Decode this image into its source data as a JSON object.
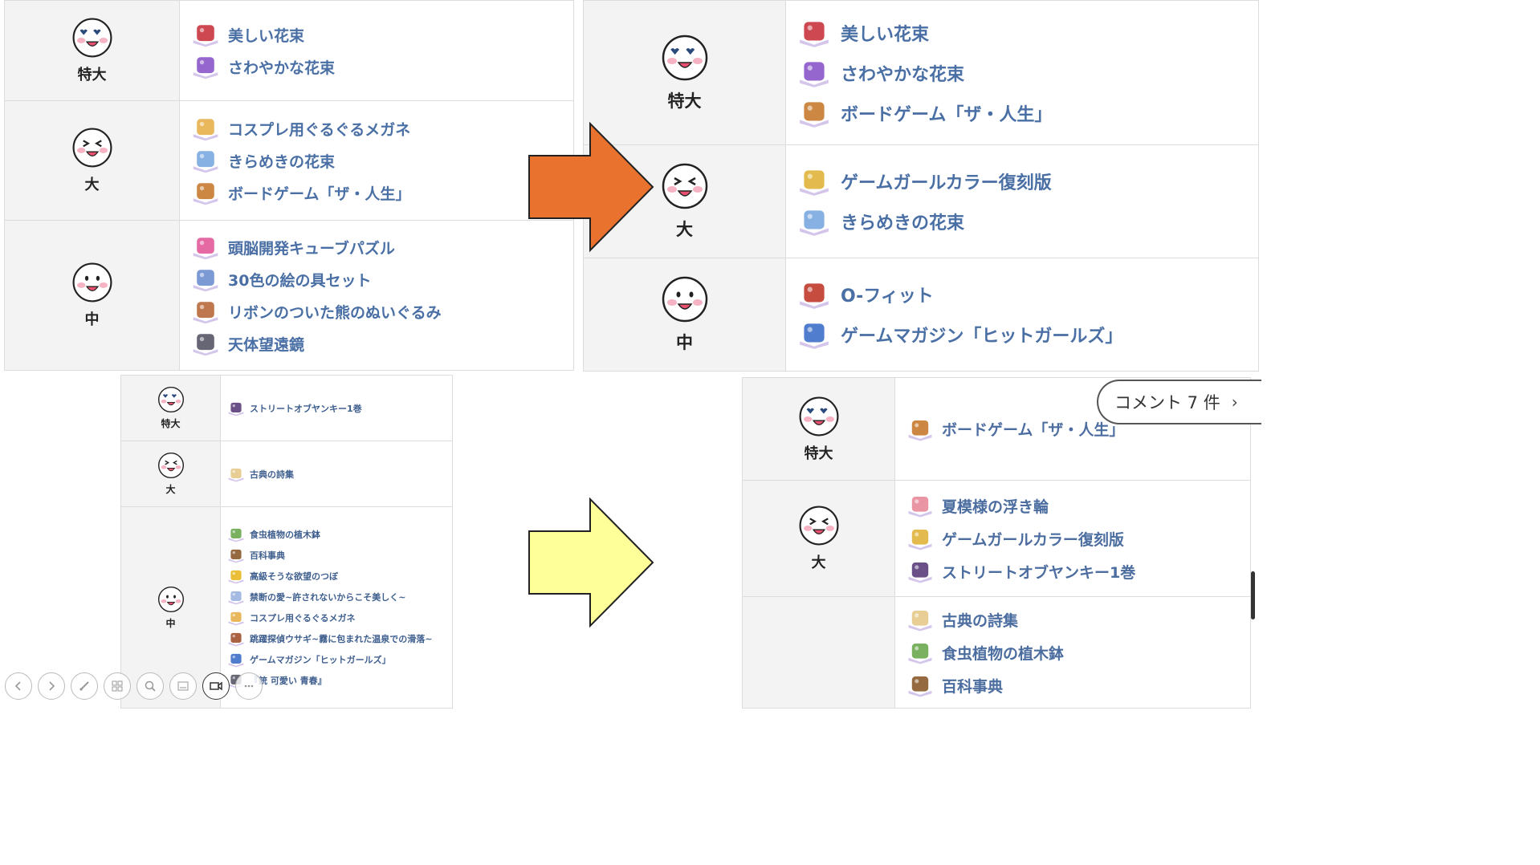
{
  "panels": [
    {
      "id": "top-left",
      "rows": [
        {
          "level": "特大",
          "face": "heart-eyes",
          "items": [
            {
              "label": "美しい花束",
              "icon": "bouquet-red-icon",
              "color": "#c8343d"
            },
            {
              "label": "さわやかな花束",
              "icon": "bouquet-purple-icon",
              "color": "#8a55c8"
            }
          ]
        },
        {
          "level": "大",
          "face": "squint",
          "items": [
            {
              "label": "コスプレ用ぐるぐるメガネ",
              "icon": "glasses-icon",
              "color": "#e8b04a"
            },
            {
              "label": "きらめきの花束",
              "icon": "bouquet-blue-icon",
              "color": "#7aa7e0"
            },
            {
              "label": "ボードゲーム「ザ・人生」",
              "icon": "board-game-icon",
              "color": "#c77a2e"
            }
          ]
        },
        {
          "level": "中",
          "face": "smile",
          "items": [
            {
              "label": "頭脳開発キューブパズル",
              "icon": "cube-puzzle-icon",
              "color": "#e25a9a"
            },
            {
              "label": "30色の絵の具セット",
              "icon": "paint-set-icon",
              "color": "#6d8fcf"
            },
            {
              "label": "リボンのついた熊のぬいぐるみ",
              "icon": "teddy-bear-icon",
              "color": "#b8693a"
            },
            {
              "label": "天体望遠鏡",
              "icon": "telescope-icon",
              "color": "#556"
            }
          ]
        }
      ]
    },
    {
      "id": "top-right",
      "rows": [
        {
          "level": "特大",
          "face": "heart-eyes",
          "items": [
            {
              "label": "美しい花束",
              "icon": "bouquet-red-icon",
              "color": "#c8343d"
            },
            {
              "label": "さわやかな花束",
              "icon": "bouquet-purple-icon",
              "color": "#8a55c8"
            },
            {
              "label": "ボードゲーム「ザ・人生」",
              "icon": "board-game-icon",
              "color": "#c77a2e"
            }
          ]
        },
        {
          "level": "大",
          "face": "squint",
          "items": [
            {
              "label": "ゲームガールカラー復刻版",
              "icon": "handheld-console-icon",
              "color": "#e0b23a"
            },
            {
              "label": "きらめきの花束",
              "icon": "bouquet-blue-icon",
              "color": "#7aa7e0"
            }
          ]
        },
        {
          "level": "中",
          "face": "smile",
          "items": [
            {
              "label": "O-フィット",
              "icon": "fitness-ring-icon",
              "color": "#c0392b"
            },
            {
              "label": "ゲームマガジン「ヒットガールズ」",
              "icon": "magazine-icon",
              "color": "#3d6fc8"
            }
          ]
        }
      ]
    },
    {
      "id": "bottom-left",
      "rows": [
        {
          "level": "特大",
          "face": "heart-eyes",
          "items": [
            {
              "label": "ストリートオブヤンキー1巻",
              "icon": "manga-icon",
              "color": "#5a3d7a"
            }
          ]
        },
        {
          "level": "大",
          "face": "squint",
          "items": [
            {
              "label": "古典の詩集",
              "icon": "poetry-book-icon",
              "color": "#e6c98a"
            }
          ]
        },
        {
          "level": "中",
          "face": "smile",
          "items": [
            {
              "label": "食虫植物の植木鉢",
              "icon": "plant-pot-icon",
              "color": "#6aa84f"
            },
            {
              "label": "百科事典",
              "icon": "encyclopedia-icon",
              "color": "#8b5a2b"
            },
            {
              "label": "高級そうな欲望のつぼ",
              "icon": "vase-icon",
              "color": "#e8b720"
            },
            {
              "label": "禁断の愛~許されないからこそ美しく~",
              "icon": "romance-book-icon",
              "color": "#9bb3e0"
            },
            {
              "label": "コスプレ用ぐるぐるメガネ",
              "icon": "glasses-icon",
              "color": "#e8b04a"
            },
            {
              "label": "跳躍探偵ウサギ~霧に包まれた温泉での滑落~",
              "icon": "detective-book-icon",
              "color": "#a0522d"
            },
            {
              "label": "ゲームマガジン「ヒットガールズ」",
              "icon": "magazine-icon",
              "color": "#3d6fc8"
            },
            {
              "label": "『銃 可愛い 青春』",
              "icon": "dvd-icon",
              "color": "#556"
            }
          ]
        }
      ]
    },
    {
      "id": "bottom-right",
      "rows": [
        {
          "level": "特大",
          "face": "heart-eyes",
          "items": [
            {
              "label": "ボードゲーム「ザ・人生」",
              "icon": "board-game-icon",
              "color": "#c77a2e"
            }
          ]
        },
        {
          "level": "大",
          "face": "squint",
          "items": [
            {
              "label": "夏模様の浮き輪",
              "icon": "float-ring-icon",
              "color": "#e88a9a"
            },
            {
              "label": "ゲームガールカラー復刻版",
              "icon": "handheld-console-icon",
              "color": "#e0b23a"
            },
            {
              "label": "ストリートオブヤンキー1巻",
              "icon": "manga-icon",
              "color": "#5a3d7a"
            }
          ]
        },
        {
          "level": "",
          "face": "",
          "items": [
            {
              "label": "古典の詩集",
              "icon": "poetry-book-icon",
              "color": "#e6c98a"
            },
            {
              "label": "食虫植物の植木鉢",
              "icon": "plant-pot-icon",
              "color": "#6aa84f"
            },
            {
              "label": "百科事典",
              "icon": "encyclopedia-icon",
              "color": "#8b5a2b"
            }
          ]
        }
      ]
    }
  ],
  "comment_button": {
    "label": "コメント 7 件",
    "chevron": "›"
  },
  "arrows": [
    {
      "id": "orange-arrow",
      "color": "#e8722e"
    },
    {
      "id": "yellow-arrow",
      "color": "#ffff99"
    }
  ],
  "toolbar": [
    {
      "icon": "previous-icon"
    },
    {
      "icon": "next-icon"
    },
    {
      "icon": "pen-icon"
    },
    {
      "icon": "slides-grid-icon"
    },
    {
      "icon": "zoom-icon"
    },
    {
      "icon": "subtitles-icon"
    },
    {
      "icon": "camera-icon"
    },
    {
      "icon": "more-icon"
    }
  ]
}
